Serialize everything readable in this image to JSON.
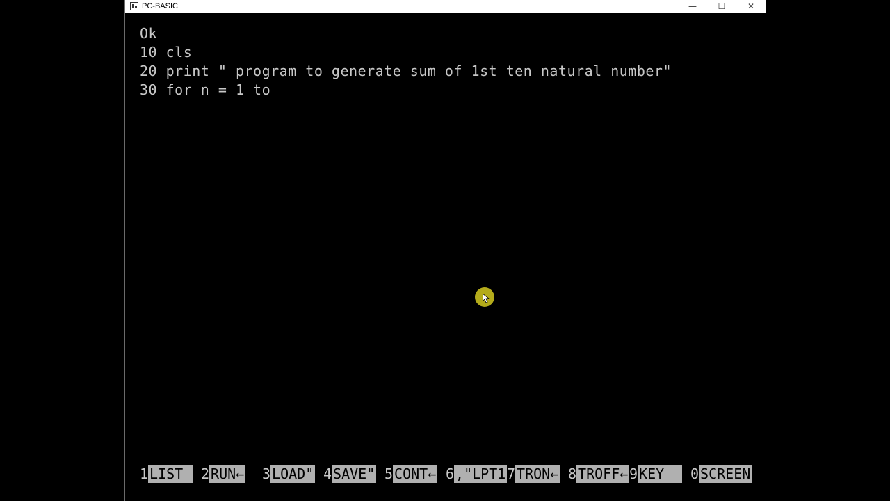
{
  "window": {
    "title": "PC-BASIC",
    "controls": {
      "minimize": "—",
      "maximize": "☐",
      "close": "✕"
    }
  },
  "screen": {
    "lines": [
      "Ok",
      "10 cls",
      "20 print \" program to generate sum of 1st ten natural number\"",
      "30 for n = 1 to"
    ]
  },
  "function_keys": [
    {
      "num": "1",
      "label": "LIST "
    },
    {
      "num": "2",
      "label": "RUN←"
    },
    {
      "num": "3",
      "label": "LOAD\""
    },
    {
      "num": "4",
      "label": "SAVE\""
    },
    {
      "num": "5",
      "label": "CONT←"
    },
    {
      "num": "6",
      "label": ",\"LPT1"
    },
    {
      "num": "7",
      "label": "TRON←"
    },
    {
      "num": "8",
      "label": "TROFF←"
    },
    {
      "num": "9",
      "label": "KEY  "
    },
    {
      "num": "0",
      "label": "SCREEN"
    }
  ],
  "colors": {
    "screen_bg": "#000000",
    "text": "#c8c8c8",
    "keybar_highlight": "#b0b0b0",
    "cursor_halo": "#c8be1e"
  }
}
